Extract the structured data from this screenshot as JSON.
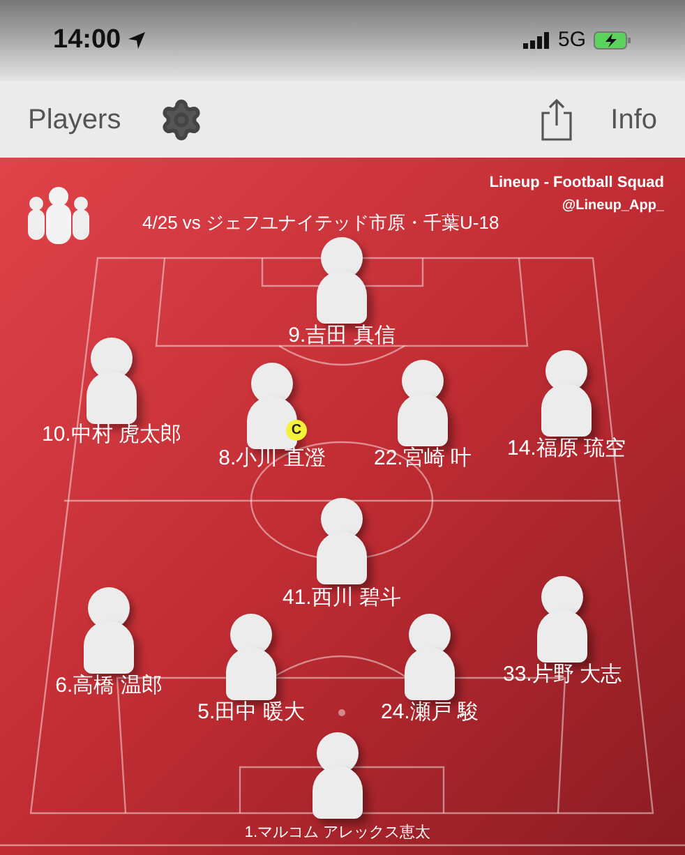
{
  "status_bar": {
    "time": "14:00",
    "network": "5G"
  },
  "nav_bar": {
    "left_button": "Players",
    "right_button": "Info"
  },
  "pitch": {
    "app_title": "Lineup - Football Squad",
    "app_handle": "@Lineup_App_",
    "match_title": "4/25 vs ジェフユナイテッド市原・千葉U-18",
    "players": [
      {
        "label": "9.吉田 真信",
        "captain": false
      },
      {
        "label": "10.中村 虎太郎",
        "captain": false
      },
      {
        "label": "8.小川 直澄",
        "captain": true
      },
      {
        "label": "22.宮崎 叶",
        "captain": false
      },
      {
        "label": "14.福原 琉空",
        "captain": false
      },
      {
        "label": "41.西川 碧斗",
        "captain": false
      },
      {
        "label": "6.高橋 温郎",
        "captain": false
      },
      {
        "label": "5.田中 暖大",
        "captain": false
      },
      {
        "label": "24.瀬戸 駿",
        "captain": false
      },
      {
        "label": "33.片野 大志",
        "captain": false
      },
      {
        "label": "1.マルコム アレックス恵太",
        "captain": false,
        "kind": "goalkeeper"
      }
    ],
    "captain_mark": "C"
  }
}
